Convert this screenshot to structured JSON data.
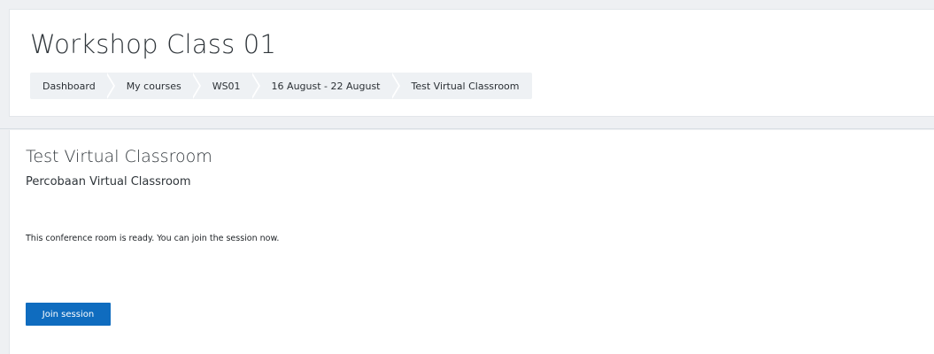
{
  "header": {
    "course_title": "Workshop Class 01",
    "breadcrumb": [
      {
        "label": "Dashboard"
      },
      {
        "label": "My courses"
      },
      {
        "label": "WS01"
      },
      {
        "label": "16 August - 22 August"
      },
      {
        "label": "Test Virtual Classroom"
      }
    ]
  },
  "main": {
    "activity_title": "Test Virtual Classroom",
    "activity_description": "Percobaan Virtual Classroom",
    "status_message": "This conference room is ready. You can join the session now.",
    "join_button_label": "Join session"
  },
  "colors": {
    "primary_button": "#0f6cbf",
    "page_background": "#eef0f3",
    "breadcrumb_background": "#eef1f4"
  }
}
